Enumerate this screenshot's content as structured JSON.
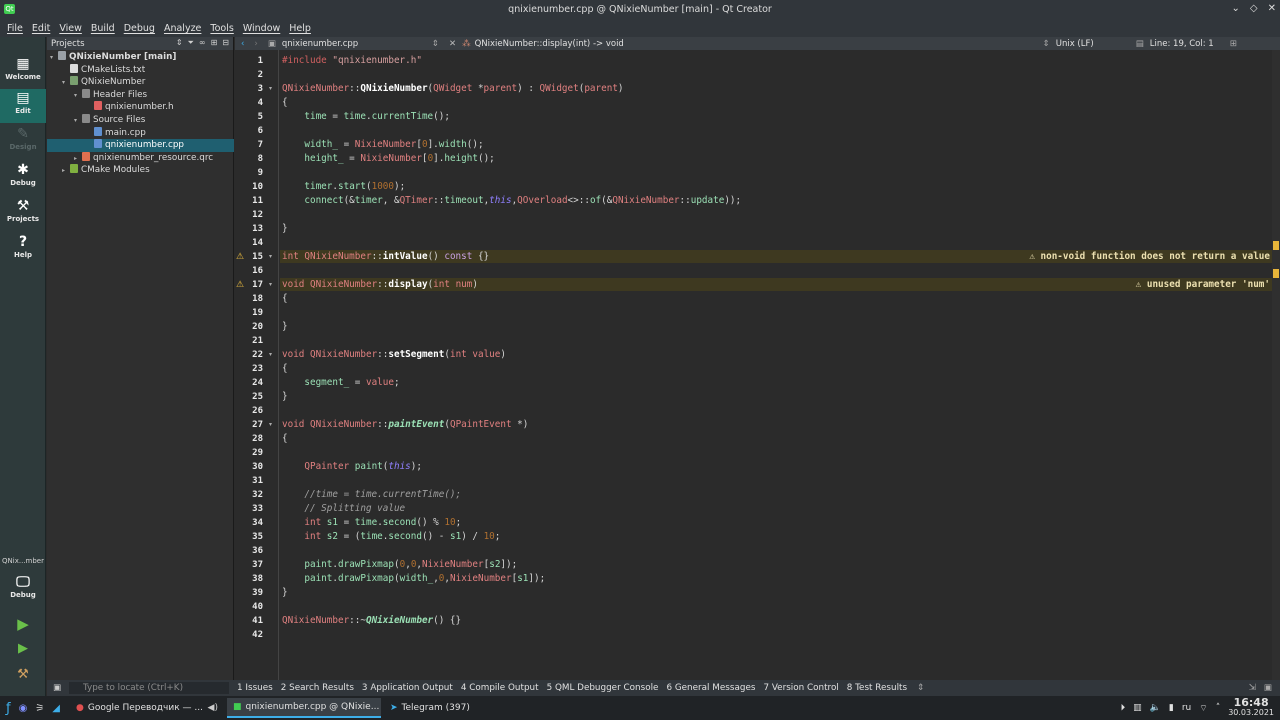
{
  "window": {
    "title": "qnixienumber.cpp @ QNixieNumber [main] - Qt Creator",
    "controls": [
      "⌄",
      "◇",
      "✕"
    ]
  },
  "menu": [
    "File",
    "Edit",
    "View",
    "Build",
    "Debug",
    "Analyze",
    "Tools",
    "Window",
    "Help"
  ],
  "modes": [
    {
      "label": "Welcome",
      "icon": "grid-icon"
    },
    {
      "label": "Edit",
      "icon": "edit-icon"
    },
    {
      "label": "Design",
      "icon": "design-icon"
    },
    {
      "label": "Debug",
      "icon": "bug-icon"
    },
    {
      "label": "Projects",
      "icon": "wrench-icon"
    },
    {
      "label": "Help",
      "icon": "help-icon"
    }
  ],
  "kit": {
    "name": "QNix...mber",
    "config": "Debug"
  },
  "projects": {
    "header": "Projects",
    "tree": [
      {
        "label": "QNixieNumber [main]",
        "level": 0,
        "arrow": "▾",
        "bold": true,
        "color": "#9aa0a6"
      },
      {
        "label": "CMakeLists.txt",
        "level": 1,
        "arrow": "",
        "color": "#dddddd"
      },
      {
        "label": "QNixieNumber",
        "level": 1,
        "arrow": "▾",
        "color": "#7aa070"
      },
      {
        "label": "Header Files",
        "level": 2,
        "arrow": "▾",
        "color": "#8a8a8a"
      },
      {
        "label": "qnixienumber.h",
        "level": 3,
        "arrow": "",
        "color": "#e06060"
      },
      {
        "label": "Source Files",
        "level": 2,
        "arrow": "▾",
        "color": "#8a8a8a"
      },
      {
        "label": "main.cpp",
        "level": 3,
        "arrow": "",
        "color": "#6090d0"
      },
      {
        "label": "qnixienumber.cpp",
        "level": 3,
        "arrow": "",
        "color": "#6090d0",
        "selected": true
      },
      {
        "label": "qnixienumber_resource.qrc",
        "level": 2,
        "arrow": "▸",
        "color": "#e07050"
      },
      {
        "label": "CMake Modules",
        "level": 1,
        "arrow": "▸",
        "color": "#80b040"
      }
    ]
  },
  "editorbar": {
    "file": "qnixienumber.cpp",
    "symbol": "QNixieNumber::display(int) -> void",
    "encoding": "Unix (LF)",
    "position": "Line: 19, Col: 1"
  },
  "warnings": [
    {
      "line": 15,
      "text": "non-void function does not return a value"
    },
    {
      "line": 17,
      "text": "unused parameter 'num'"
    }
  ],
  "code": [
    [
      [
        "pp",
        "#include "
      ],
      [
        "str",
        "\"qnixienumber.h\""
      ]
    ],
    [],
    [
      [
        "pink",
        "QNixieNumber"
      ],
      [
        "",
        "::"
      ],
      [
        "fn",
        "QNixieNumber"
      ],
      [
        "",
        "("
      ],
      [
        "pink",
        "QWidget"
      ],
      [
        "",
        " *"
      ],
      [
        "pink",
        "parent"
      ],
      [
        "",
        ") : "
      ],
      [
        "pink",
        "QWidget"
      ],
      [
        "",
        "("
      ],
      [
        "pink",
        "parent"
      ],
      [
        "",
        ")"
      ]
    ],
    [
      [
        "",
        "{"
      ]
    ],
    [
      [
        "",
        "    "
      ],
      [
        "grn",
        "time"
      ],
      [
        "",
        " = "
      ],
      [
        "grn",
        "time"
      ],
      [
        "",
        "."
      ],
      [
        "grn",
        "currentTime"
      ],
      [
        "",
        "();"
      ]
    ],
    [],
    [
      [
        "",
        "    "
      ],
      [
        "grn",
        "width_"
      ],
      [
        "",
        " = "
      ],
      [
        "pink",
        "NixieNumber"
      ],
      [
        "",
        "["
      ],
      [
        "num",
        "0"
      ],
      [
        "",
        "]."
      ],
      [
        "grn",
        "width"
      ],
      [
        "",
        "();"
      ]
    ],
    [
      [
        "",
        "    "
      ],
      [
        "grn",
        "height_"
      ],
      [
        "",
        " = "
      ],
      [
        "pink",
        "NixieNumber"
      ],
      [
        "",
        "["
      ],
      [
        "num",
        "0"
      ],
      [
        "",
        "]."
      ],
      [
        "grn",
        "height"
      ],
      [
        "",
        "();"
      ]
    ],
    [],
    [
      [
        "",
        "    "
      ],
      [
        "grn",
        "timer"
      ],
      [
        "",
        "."
      ],
      [
        "grn",
        "start"
      ],
      [
        "",
        "("
      ],
      [
        "num",
        "1000"
      ],
      [
        "",
        ");"
      ]
    ],
    [
      [
        "",
        "    "
      ],
      [
        "grn",
        "connect"
      ],
      [
        "",
        "(&"
      ],
      [
        "grn",
        "timer"
      ],
      [
        "",
        ", &"
      ],
      [
        "pink",
        "QTimer"
      ],
      [
        "",
        "::"
      ],
      [
        "grn",
        "timeout"
      ],
      [
        "",
        ","
      ],
      [
        "th",
        "this"
      ],
      [
        "",
        ","
      ],
      [
        "pink",
        "QOverload"
      ],
      [
        "",
        "<>::"
      ],
      [
        "grn",
        "of"
      ],
      [
        "",
        "(&"
      ],
      [
        "pink",
        "QNixieNumber"
      ],
      [
        "",
        "::"
      ],
      [
        "grn",
        "update"
      ],
      [
        "",
        "));"
      ]
    ],
    [],
    [
      [
        "",
        "}"
      ]
    ],
    [],
    [
      [
        "pink",
        "int"
      ],
      [
        "",
        " "
      ],
      [
        "pink",
        "QNixieNumber"
      ],
      [
        "",
        "::"
      ],
      [
        "fn",
        "intValue"
      ],
      [
        "",
        "() "
      ],
      [
        "typ",
        "const"
      ],
      [
        "",
        " {}"
      ]
    ],
    [],
    [
      [
        "pink",
        "void"
      ],
      [
        "",
        " "
      ],
      [
        "pink",
        "QNixieNumber"
      ],
      [
        "",
        "::"
      ],
      [
        "fn",
        "display"
      ],
      [
        "",
        "("
      ],
      [
        "pink",
        "int"
      ],
      [
        "",
        " "
      ],
      [
        "pink",
        "num"
      ],
      [
        "",
        ")"
      ]
    ],
    [
      [
        "",
        "{"
      ]
    ],
    [],
    [
      [
        "",
        "}"
      ]
    ],
    [],
    [
      [
        "pink",
        "void"
      ],
      [
        "",
        " "
      ],
      [
        "pink",
        "QNixieNumber"
      ],
      [
        "",
        "::"
      ],
      [
        "fn",
        "setSegment"
      ],
      [
        "",
        "("
      ],
      [
        "pink",
        "int"
      ],
      [
        "",
        " "
      ],
      [
        "pink",
        "value"
      ],
      [
        "",
        ")"
      ]
    ],
    [
      [
        "",
        "{"
      ]
    ],
    [
      [
        "",
        "    "
      ],
      [
        "grn",
        "segment_"
      ],
      [
        "",
        " = "
      ],
      [
        "pink",
        "value"
      ],
      [
        "",
        ";"
      ]
    ],
    [
      [
        "",
        "}"
      ]
    ],
    [],
    [
      [
        "pink",
        "void"
      ],
      [
        "",
        " "
      ],
      [
        "pink",
        "QNixieNumber"
      ],
      [
        "",
        "::"
      ],
      [
        "fni",
        "paintEvent"
      ],
      [
        "",
        "("
      ],
      [
        "pink",
        "QPaintEvent"
      ],
      [
        "",
        " *)"
      ]
    ],
    [
      [
        "",
        "{"
      ]
    ],
    [],
    [
      [
        "",
        "    "
      ],
      [
        "pink",
        "QPainter"
      ],
      [
        "",
        " "
      ],
      [
        "grn",
        "paint"
      ],
      [
        "",
        "("
      ],
      [
        "th",
        "this"
      ],
      [
        "",
        ");"
      ]
    ],
    [],
    [
      [
        "",
        "    "
      ],
      [
        "cm",
        "//time = time.currentTime();"
      ]
    ],
    [
      [
        "",
        "    "
      ],
      [
        "cm",
        "// Splitting value"
      ]
    ],
    [
      [
        "",
        "    "
      ],
      [
        "pink",
        "int"
      ],
      [
        "",
        " "
      ],
      [
        "grn",
        "s1"
      ],
      [
        "",
        " = "
      ],
      [
        "grn",
        "time"
      ],
      [
        "",
        "."
      ],
      [
        "grn",
        "second"
      ],
      [
        "",
        "() % "
      ],
      [
        "num",
        "10"
      ],
      [
        "",
        ";"
      ]
    ],
    [
      [
        "",
        "    "
      ],
      [
        "pink",
        "int"
      ],
      [
        "",
        " "
      ],
      [
        "grn",
        "s2"
      ],
      [
        "",
        " = ("
      ],
      [
        "grn",
        "time"
      ],
      [
        "",
        "."
      ],
      [
        "grn",
        "second"
      ],
      [
        "",
        "() - "
      ],
      [
        "grn",
        "s1"
      ],
      [
        "",
        ") / "
      ],
      [
        "num",
        "10"
      ],
      [
        "",
        ";"
      ]
    ],
    [],
    [
      [
        "",
        "    "
      ],
      [
        "grn",
        "paint"
      ],
      [
        "",
        "."
      ],
      [
        "grn",
        "drawPixmap"
      ],
      [
        "",
        "("
      ],
      [
        "num",
        "0"
      ],
      [
        "",
        ","
      ],
      [
        "num",
        "0"
      ],
      [
        "",
        ","
      ],
      [
        "pink",
        "NixieNumber"
      ],
      [
        "",
        "["
      ],
      [
        "grn",
        "s2"
      ],
      [
        "",
        "]);"
      ]
    ],
    [
      [
        "",
        "    "
      ],
      [
        "grn",
        "paint"
      ],
      [
        "",
        "."
      ],
      [
        "grn",
        "drawPixmap"
      ],
      [
        "",
        "("
      ],
      [
        "grn",
        "width_"
      ],
      [
        "",
        ","
      ],
      [
        "num",
        "0"
      ],
      [
        "",
        ","
      ],
      [
        "pink",
        "NixieNumber"
      ],
      [
        "",
        "["
      ],
      [
        "grn",
        "s1"
      ],
      [
        "",
        "]);"
      ]
    ],
    [
      [
        "",
        "}"
      ]
    ],
    [],
    [
      [
        "pink",
        "QNixieNumber"
      ],
      [
        "",
        "::~"
      ],
      [
        "fni",
        "QNixieNumber"
      ],
      [
        "",
        "() {}"
      ]
    ],
    []
  ],
  "folds": [
    3,
    15,
    17,
    22,
    27
  ],
  "output": {
    "locator": "Type to locate (Ctrl+K)",
    "tabs": [
      "1  Issues",
      "2  Search Results",
      "3  Application Output",
      "4  Compile Output",
      "5  QML Debugger Console",
      "6  General Messages",
      "7  Version Control",
      "8  Test Results"
    ]
  },
  "taskbar": {
    "tasks": [
      {
        "label": "Google Переводчик — ...",
        "color": "#e05050"
      },
      {
        "label": "qnixienumber.cpp @ QNixie...",
        "color": "#41cd52",
        "active": true
      },
      {
        "label": "Telegram (397)",
        "color": "#3daee9"
      }
    ],
    "lang": "ru",
    "time": "16:48",
    "date": "30.03.2021"
  }
}
